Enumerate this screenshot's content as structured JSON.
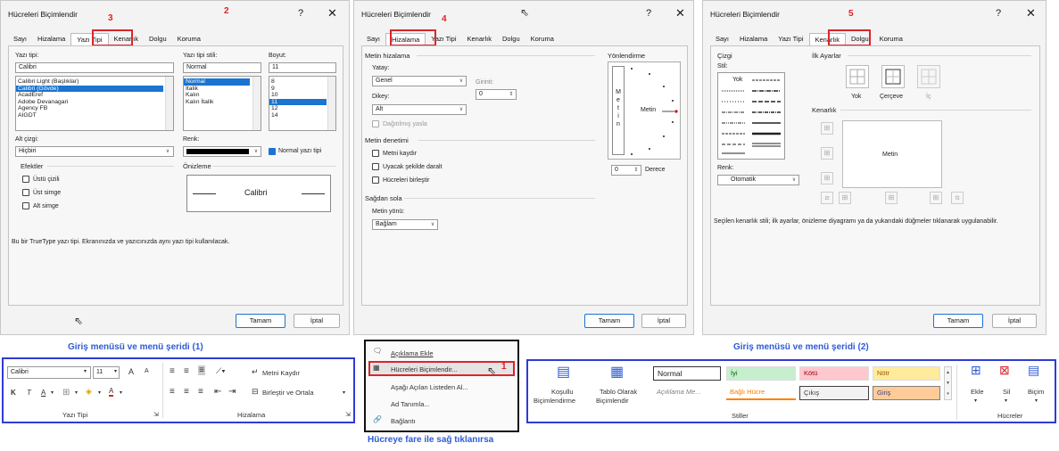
{
  "d1": {
    "title": "Hücreleri Biçimlendir",
    "marker": "2",
    "tabs": [
      "Sayı",
      "Hizalama",
      "Yazı Tipi",
      "Kenarlık",
      "Dolgu",
      "Koruma"
    ],
    "tab_marker": "3",
    "font_label": "Yazı tipi:",
    "font_value": "Calibri",
    "font_list": [
      "Calibri Light (Başlıklar)",
      "Calibri (Gövde)",
      "AcadEref",
      "Adobe Devanagari",
      "Agency FB",
      "AIGDT"
    ],
    "style_label": "Yazı tipi stili:",
    "style_value": "Normal",
    "style_list": [
      "Normal",
      "İtalik",
      "Kalın",
      "Kalın İtalik"
    ],
    "size_label": "Boyut:",
    "size_value": "11",
    "size_list": [
      "8",
      "9",
      "10",
      "11",
      "12",
      "14"
    ],
    "underline_label": "Alt çizgi:",
    "underline_value": "Hiçbiri",
    "color_label": "Renk:",
    "normal_font_label": "Normal yazı tipi",
    "effects_label": "Efektler",
    "effects": [
      "Üstü çizili",
      "Üst simge",
      "Alt simge"
    ],
    "preview_label": "Önizleme",
    "preview_text": "Calibri",
    "info": "Bu bir TrueType yazı tipi. Ekranınızda ve yazıcınızda aynı yazı tipi kullanılacak.",
    "ok": "Tamam",
    "cancel": "İptal"
  },
  "d2": {
    "title": "Hücreleri Biçimlendir",
    "tabs": [
      "Sayı",
      "Hizalama",
      "Yazı Tipi",
      "Kenarlık",
      "Dolgu",
      "Koruma"
    ],
    "tab_marker": "4",
    "align_label": "Metin hizalama",
    "horiz_label": "Yatay:",
    "horiz_value": "Genel",
    "indent_label": "Girinti:",
    "indent_value": "0",
    "vert_label": "Dikey:",
    "vert_value": "Alt",
    "distributed_label": "Dağıtılmış yasla",
    "control_label": "Metin denetimi",
    "controls": [
      "Metni kaydır",
      "Uyacak şekilde daralt",
      "Hücreleri birleştir"
    ],
    "rtl_label": "Sağdan sola",
    "dir_label": "Metin yönü:",
    "dir_value": "Bağlam",
    "orient_label": "Yönlendirme",
    "vertical_text": [
      "M",
      "e",
      "t",
      "i",
      "n"
    ],
    "orient_text": "Metin",
    "degree_value": "0",
    "degree_label": "Derece",
    "ok": "Tamam",
    "cancel": "İptal"
  },
  "d3": {
    "title": "Hücreleri Biçimlendir",
    "tabs": [
      "Sayı",
      "Hizalama",
      "Yazı Tipi",
      "Kenarlık",
      "Dolgu",
      "Koruma"
    ],
    "tab_marker": "5",
    "line_label": "Çizgi",
    "style_label": "Stil:",
    "none_label": "Yok",
    "color_label": "Renk:",
    "color_value": "Otomatik",
    "presets_label": "İlk Ayarlar",
    "presets": [
      "Yok",
      "Çerçeve",
      "İç"
    ],
    "border_label": "Kenarlık",
    "preview_text": "Metin",
    "info": "Seçilen kenarlık stili; ilk ayarlar, önizleme diyagramı ya da yukarıdaki düğmeler tıklanarak uygulanabilir.",
    "ok": "Tamam",
    "cancel": "İptal"
  },
  "ribbon1": {
    "caption": "Giriş menüsü ve menü şeridi (1)",
    "font": "Calibri",
    "size": "11",
    "grow": "A",
    "shrink": "A",
    "bold": "K",
    "italic": "T",
    "underline": "A",
    "fontcolor": "A",
    "wrap": "Metni Kaydır",
    "merge": "Birleştir ve Ortala",
    "group_font": "Yazı Tipi",
    "group_align": "Hizalama"
  },
  "context": {
    "items": [
      "Açıklama Ekle",
      "Hücreleri Biçimlendir...",
      "Aşağı Açılan Listeden Al...",
      "Ad Tanımla...",
      "Bağlantı"
    ],
    "marker": "1",
    "caption": "Hücreye fare ile sağ tıklanırsa"
  },
  "ribbon2": {
    "caption": "Giriş menüsü ve menü şeridi (2)",
    "cond1": "Koşullu",
    "cond2": "Biçimlendirme",
    "table1": "Tablo Olarak",
    "table2": "Biçimlendir",
    "styles": [
      "Normal",
      "İyi",
      "Kötü",
      "Nötr",
      "Açıklama Me...",
      "Bağlı Hücre",
      "Çıkış",
      "Giriş"
    ],
    "group_styles": "Stiller",
    "insert": "Ekle",
    "delete": "Sil",
    "format": "Biçim",
    "group_cells": "Hücreler"
  }
}
